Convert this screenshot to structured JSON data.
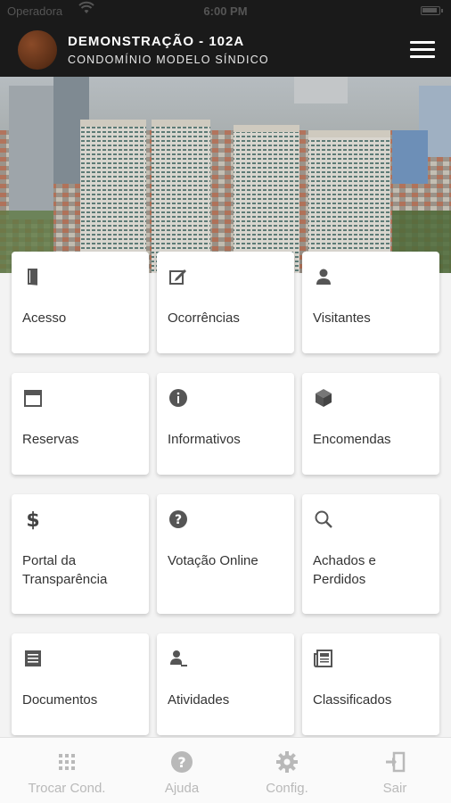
{
  "status_bar": {
    "carrier": "Operadora",
    "time": "6:00 PM"
  },
  "header": {
    "title": "DEMONSTRAÇÃO - 102A",
    "subtitle": "CONDOMÍNIO MODELO SÍNDICO"
  },
  "tiles": [
    {
      "label": "Acesso",
      "icon": "door-icon"
    },
    {
      "label": "Ocorrências",
      "icon": "edit-icon"
    },
    {
      "label": "Visitantes",
      "icon": "person-icon"
    },
    {
      "label": "Reservas",
      "icon": "calendar-icon"
    },
    {
      "label": "Informativos",
      "icon": "info-icon"
    },
    {
      "label": "Encomendas",
      "icon": "package-icon"
    },
    {
      "label": "Portal da Transparência",
      "icon": "dollar-icon"
    },
    {
      "label": "Votação Online",
      "icon": "question-icon"
    },
    {
      "label": "Achados e Perdidos",
      "icon": "search-icon"
    },
    {
      "label": "Documentos",
      "icon": "document-icon"
    },
    {
      "label": "Atividades",
      "icon": "activity-icon"
    },
    {
      "label": "Classificados",
      "icon": "newspaper-icon"
    }
  ],
  "tabbar": [
    {
      "label": "Trocar Cond.",
      "icon": "grid-icon"
    },
    {
      "label": "Ajuda",
      "icon": "help-icon"
    },
    {
      "label": "Config.",
      "icon": "gear-icon"
    },
    {
      "label": "Sair",
      "icon": "logout-icon"
    }
  ],
  "colors": {
    "header_bg": "#1a1a1a",
    "tile_bg": "#ffffff",
    "icon": "#555555",
    "tab_inactive": "#b9b9b9"
  }
}
